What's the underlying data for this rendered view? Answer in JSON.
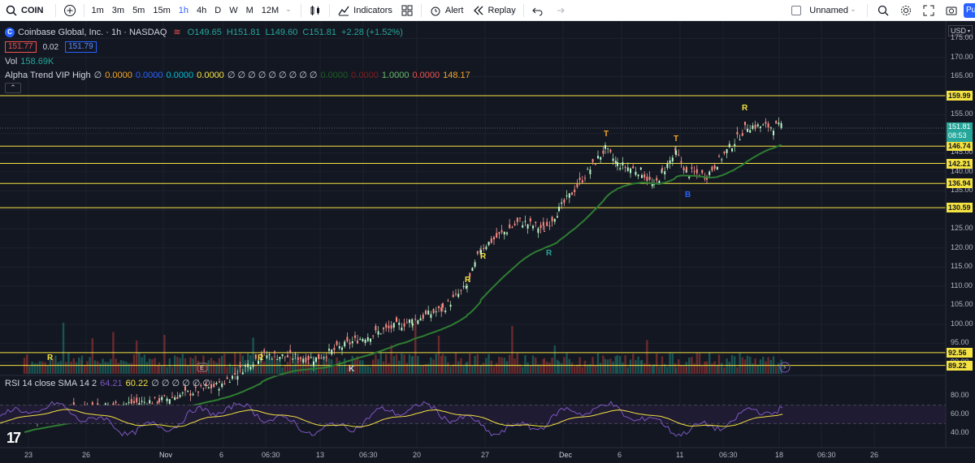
{
  "toolbar": {
    "symbol": "COIN",
    "intervals": [
      "1m",
      "3m",
      "5m",
      "15m",
      "1h",
      "4h",
      "D",
      "W",
      "M",
      "12M"
    ],
    "active_interval": "1h",
    "indicators_label": "Indicators",
    "alert_label": "Alert",
    "replay_label": "Replay",
    "layout_name": "Unnamed",
    "publish_label": "Pu"
  },
  "legend": {
    "title": "Coinbase Global, Inc. · 1h · NASDAQ",
    "open": "O149.65",
    "high": "H151.81",
    "low": "L149.60",
    "close": "C151.81",
    "change": "+2.28 (+1.52%)",
    "bid": "151.77",
    "spread": "0.02",
    "ask": "151.79",
    "vol_label": "Vol",
    "vol_value": "158.69K",
    "alpha_label": "Alpha Trend VIP High",
    "alpha_values": [
      "∅",
      "0.0000",
      "0.0000",
      "0.0000",
      "0.0000",
      "∅ ∅ ∅ ∅ ∅ ∅ ∅ ∅ ∅",
      "0.0000",
      "0.0000",
      "1.0000",
      "0.0000",
      "148.17"
    ],
    "rsi_label": "RSI 14 close SMA 14 2",
    "rsi_value": "64.21",
    "rsi_sma": "60.22",
    "rsi_empty": "∅ ∅ ∅ ∅ ∅ ∅"
  },
  "price_axis": {
    "currency": "USD",
    "ticks": [
      "175.00",
      "170.00",
      "165.00",
      "160.00",
      "155.00",
      "150.00",
      "145.00",
      "140.00",
      "135.00",
      "130.00",
      "125.00",
      "120.00",
      "115.00",
      "110.00",
      "105.00",
      "100.00",
      "95.00",
      "90.00"
    ],
    "rsi_ticks": [
      "80.00",
      "60.00",
      "40.00"
    ],
    "levels": [
      "159.99",
      "146.74",
      "142.21",
      "136.94",
      "130.59",
      "92.56",
      "89.22"
    ],
    "last_price": "151.81",
    "countdown": "08:53"
  },
  "time_axis": [
    "23",
    "26",
    "Nov",
    "6",
    "06:30",
    "13",
    "06:30",
    "20",
    "27",
    "Dec",
    "6",
    "11",
    "06:30",
    "18",
    "06:30",
    "26"
  ],
  "annotations": [
    "R",
    "R",
    "K",
    "R",
    "R",
    "R",
    "T",
    "T",
    "B",
    "R"
  ],
  "colors": {
    "up": "#26a69a",
    "down": "#ef5350",
    "level": "#f5e342",
    "trend": "#2e7d32",
    "rsi": "#7e57c2",
    "rsi_ma": "#f5e342"
  },
  "chart_data": {
    "type": "candlestick",
    "symbol": "COIN",
    "interval": "1h",
    "anchors": [
      {
        "x": "Oct 23",
        "close": 76
      },
      {
        "x": "Oct 26",
        "close": 78
      },
      {
        "x": "Nov 1",
        "close": 80
      },
      {
        "x": "Nov 6",
        "close": 84
      },
      {
        "x": "Nov 9",
        "close": 92
      },
      {
        "x": "Nov 13",
        "close": 91
      },
      {
        "x": "Nov 15",
        "close": 96
      },
      {
        "x": "Nov 20",
        "close": 101
      },
      {
        "x": "Nov 22",
        "close": 104
      },
      {
        "x": "Nov 24",
        "close": 110
      },
      {
        "x": "Nov 27",
        "close": 120
      },
      {
        "x": "Nov 29",
        "close": 127
      },
      {
        "x": "Nov 30",
        "close": 125
      },
      {
        "x": "Dec 1",
        "close": 130
      },
      {
        "x": "Dec 4",
        "close": 146
      },
      {
        "x": "Dec 5",
        "close": 142
      },
      {
        "x": "Dec 6",
        "close": 140
      },
      {
        "x": "Dec 7",
        "close": 136
      },
      {
        "x": "Dec 8",
        "close": 140
      },
      {
        "x": "Dec 11",
        "close": 145
      },
      {
        "x": "Dec 12",
        "close": 140
      },
      {
        "x": "Dec 13",
        "close": 139
      },
      {
        "x": "Dec 14",
        "close": 143
      },
      {
        "x": "Dec 15",
        "close": 152
      },
      {
        "x": "Dec 18",
        "close": 151.81
      }
    ],
    "levels": [
      159.99,
      146.74,
      142.21,
      136.94,
      130.59,
      92.56,
      89.22
    ],
    "ylim": [
      88,
      177
    ],
    "rsi_ylim": [
      30,
      90
    ]
  }
}
